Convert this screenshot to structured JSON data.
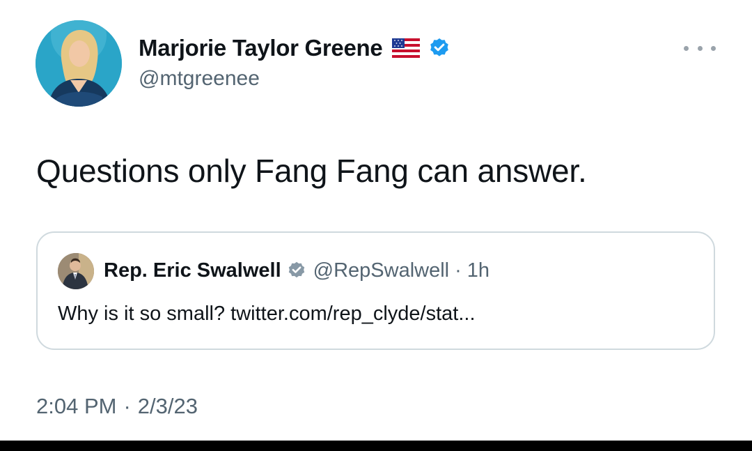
{
  "tweet": {
    "author": {
      "name": "Marjorie Taylor Greene",
      "handle": "@mtgreenee",
      "flag_icon": "us-flag-emoji",
      "verified_icon": "verified-badge-icon"
    },
    "more_icon": "more-options-icon",
    "text": "Questions only Fang Fang can answer.",
    "quote": {
      "name": "Rep. Eric Swalwell",
      "verified_icon": "verified-badge-icon",
      "handle": "@RepSwalwell",
      "separator": "·",
      "time": "1h",
      "text": "Why is it so small? twitter.com/rep_clyde/stat..."
    },
    "timestamp": {
      "time": "2:04 PM",
      "separator": "·",
      "date": "2/3/23"
    }
  },
  "colors": {
    "text_primary": "#0f1419",
    "text_secondary": "#536471",
    "verified_blue": "#1d9bf0",
    "border": "#cfd9de",
    "bottom_bar": "#000000"
  }
}
